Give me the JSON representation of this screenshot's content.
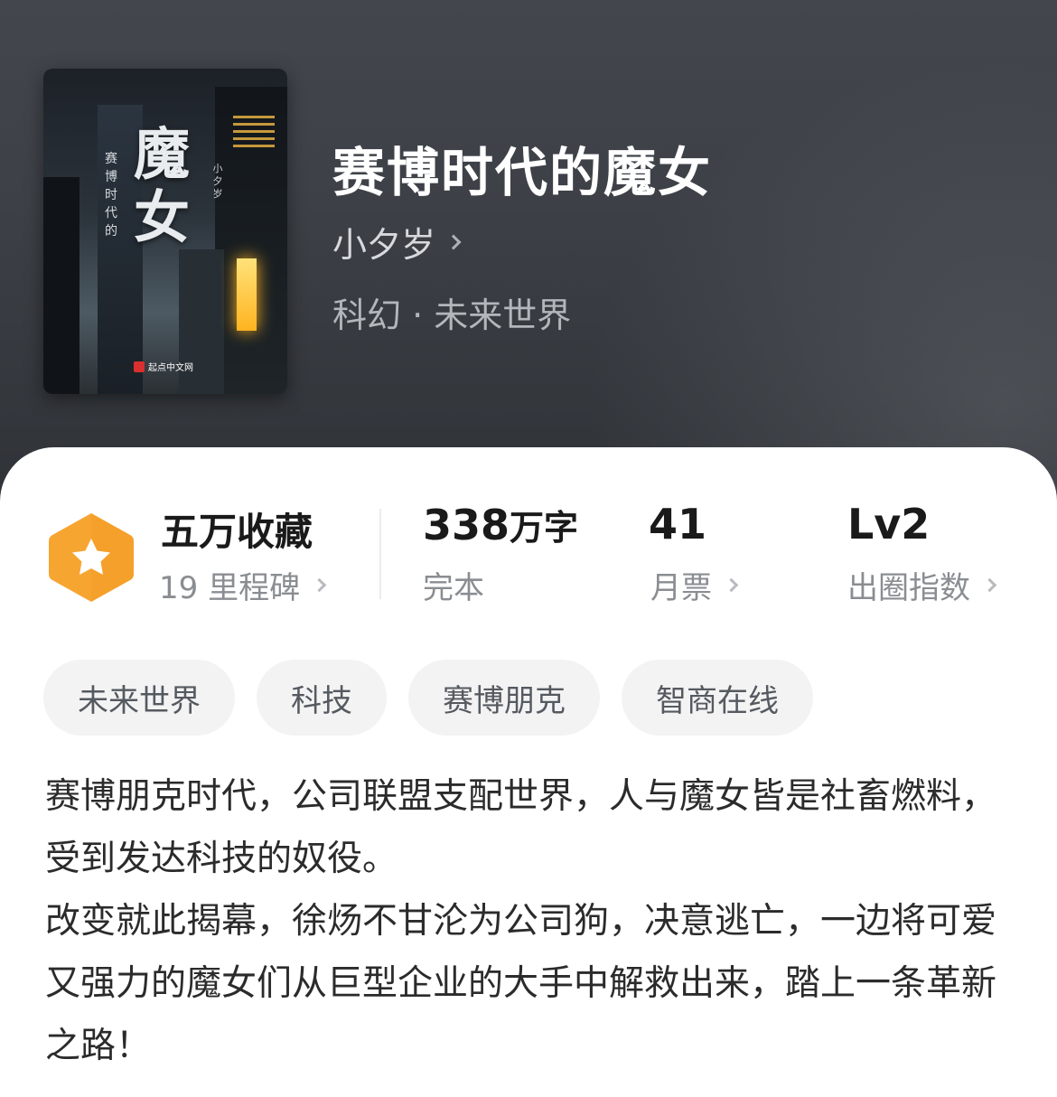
{
  "book": {
    "title": "赛博时代的魔女",
    "author": "小夕岁",
    "genre": "科幻 · 未来世界"
  },
  "cover": {
    "title_line1": "魔",
    "title_line2": "女",
    "subtitle": "赛博时代的",
    "author": "小夕岁",
    "publisher": "起点中文网"
  },
  "stats": {
    "collections": {
      "value": "五万收藏",
      "sub": "19 里程碑"
    },
    "words": {
      "number": "338",
      "unit": "万字",
      "sub": "完本"
    },
    "tickets": {
      "value": "41",
      "sub": "月票"
    },
    "index": {
      "value": "Lv2",
      "sub": "出圈指数"
    }
  },
  "tags": [
    "未来世界",
    "科技",
    "赛博朋克",
    "智商在线"
  ],
  "description": [
    "赛博朋克时代，公司联盟支配世界，人与魔女皆是社畜燃料，受到发达科技的奴役。",
    "改变就此揭幕，徐炀不甘沦为公司狗，决意逃亡，一边将可爱又强力的魔女们从巨型企业的大手中解救出来，踏上一条革新之路！"
  ],
  "colors": {
    "header_bg": "#3d4147",
    "badge_orange": "#f7a531",
    "text_primary": "#1a1a1a",
    "text_secondary": "#8a8d91"
  },
  "icons": [
    "star-badge-icon",
    "chevron-right-icon"
  ]
}
